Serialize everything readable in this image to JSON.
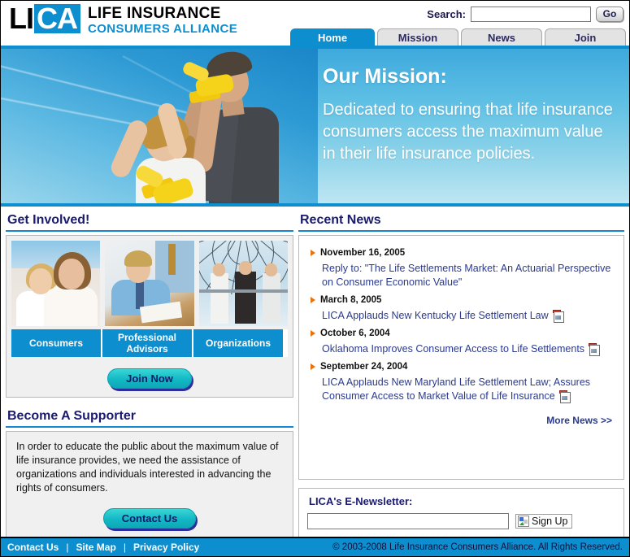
{
  "site": {
    "logo_li": "LI",
    "logo_ca": "CA",
    "title_line1": "LIFE INSURANCE",
    "title_line2": "CONSUMERS ALLIANCE",
    "accent_blue": "#0d8ecf",
    "heading_navy": "#1a1a70",
    "link_blue": "#2b3a8f",
    "bullet_orange": "#e8730c",
    "button_teal": "#12b8c4"
  },
  "search": {
    "label": "Search:",
    "value": "",
    "placeholder": "",
    "button_label": "Go"
  },
  "tabs": [
    {
      "label": "Home",
      "active": true
    },
    {
      "label": "Mission",
      "active": false
    },
    {
      "label": "News",
      "active": false
    },
    {
      "label": "Join",
      "active": false
    }
  ],
  "hero": {
    "title": "Our Mission:",
    "body": "Dedicated to ensuring that life insurance consumers access the maximum value in their life insurance policies.",
    "photo_alt": "father-and-daughter-flying-kite"
  },
  "get_involved": {
    "heading": "Get Involved!",
    "cards": [
      {
        "label": "Consumers",
        "image_alt": "mother-and-child-photo"
      },
      {
        "label": "Professional Advisors",
        "image_alt": "advisor-meeting-photo"
      },
      {
        "label": "Organizations",
        "image_alt": "business-people-atrium-photo"
      }
    ],
    "join_button": "Join Now"
  },
  "supporter": {
    "heading": "Become A Supporter",
    "body": "In order to educate the public about the maximum value of life insurance provides, we need the assistance of organizations and individuals interested in advancing the rights of consumers.",
    "contact_button": "Contact Us"
  },
  "news": {
    "heading": "Recent News",
    "items": [
      {
        "date": "November 16, 2005",
        "headline": "Reply to: \"The Life Settlements Market: An Actuarial Perspective on Consumer Economic Value\"",
        "has_pdf": false
      },
      {
        "date": "March 8, 2005",
        "headline": "LICA Applauds New Kentucky Life Settlement Law",
        "has_pdf": true
      },
      {
        "date": "October 6, 2004",
        "headline": "Oklahoma Improves Consumer Access to Life Settlements",
        "has_pdf": true
      },
      {
        "date": "September 24, 2004",
        "headline": "LICA Applauds New Maryland Life Settlement Law; Assures Consumer Access to Market Value of Life Insurance",
        "has_pdf": true
      }
    ],
    "more_link": "More News >>"
  },
  "newsletter": {
    "heading": "LICA's E-Newsletter:",
    "value": "",
    "placeholder": "",
    "signup_label": "Sign Up"
  },
  "footer": {
    "links": [
      "Contact Us",
      "Site Map",
      "Privacy Policy"
    ],
    "separator": "|",
    "copyright": "© 2003-2008 Life Insurance Consumers Alliance. All Rights Reserved."
  }
}
